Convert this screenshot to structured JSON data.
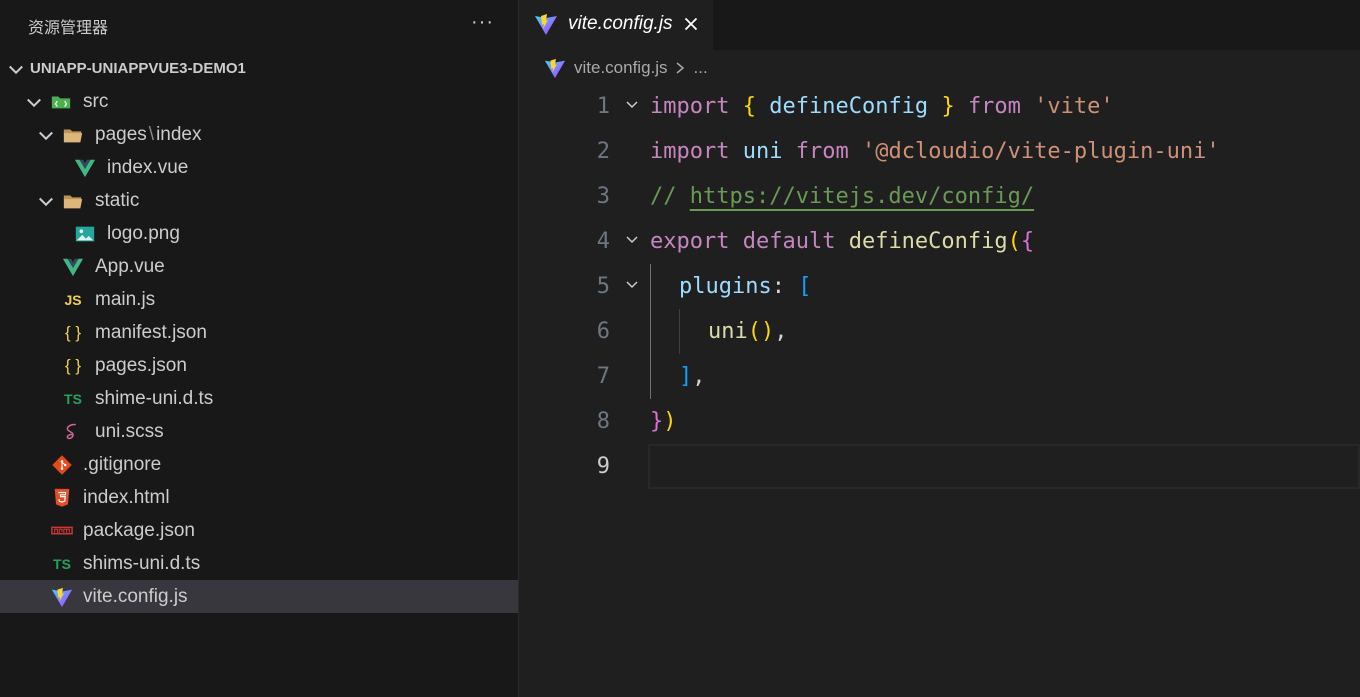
{
  "explorer": {
    "title": "资源管理器",
    "more": "···",
    "project": "UNIAPP-UNIAPPVUE3-DEMO1",
    "items": [
      {
        "label": "src"
      },
      {
        "label": "pages",
        "sep": "\\",
        "label2": "index"
      },
      {
        "label": "index.vue"
      },
      {
        "label": "static"
      },
      {
        "label": "logo.png"
      },
      {
        "label": "App.vue"
      },
      {
        "label": "main.js",
        "icon_text": "JS"
      },
      {
        "label": "manifest.json",
        "icon_text": "{ }"
      },
      {
        "label": "pages.json",
        "icon_text": "{ }"
      },
      {
        "label": "shime-uni.d.ts",
        "icon_text": "TS"
      },
      {
        "label": "uni.scss"
      },
      {
        "label": ".gitignore"
      },
      {
        "label": "index.html"
      },
      {
        "label": "package.json"
      },
      {
        "label": "shims-uni.d.ts",
        "icon_text": "TS"
      },
      {
        "label": "vite.config.js"
      }
    ]
  },
  "editor": {
    "tab": {
      "label": "vite.config.js"
    },
    "breadcrumb": {
      "file": "vite.config.js",
      "more": "..."
    },
    "line_numbers": [
      "1",
      "2",
      "3",
      "4",
      "5",
      "6",
      "7",
      "8",
      "9"
    ],
    "code": {
      "l1": {
        "kw1": "import",
        "b1": "{",
        "name": "defineConfig",
        "b2": "}",
        "kw2": "from",
        "str": "'vite'"
      },
      "l2": {
        "kw1": "import",
        "name": "uni",
        "kw2": "from",
        "str": "'@dcloudio/vite-plugin-uni'"
      },
      "l3": {
        "prefix": "//",
        "link": "https://vitejs.dev/config/"
      },
      "l4": {
        "kw1": "export",
        "kw2": "default",
        "fn": "defineConfig",
        "b1": "(",
        "b2": "{"
      },
      "l5": {
        "prop": "plugins",
        "colon": ":",
        "b": "["
      },
      "l6": {
        "fn": "uni",
        "call": "()",
        "comma": ","
      },
      "l7": {
        "b": "]",
        "comma": ","
      },
      "l8": {
        "b1": "}",
        "b2": ")"
      }
    }
  },
  "colors": {
    "keyword": "#c586c0",
    "variable": "#9cdcfe",
    "function": "#dcdcaa",
    "string": "#ce9178",
    "comment": "#6a9955",
    "vue_green": "#41b883",
    "js_yellow": "#f1d14a",
    "ts_green": "#21a35b"
  }
}
